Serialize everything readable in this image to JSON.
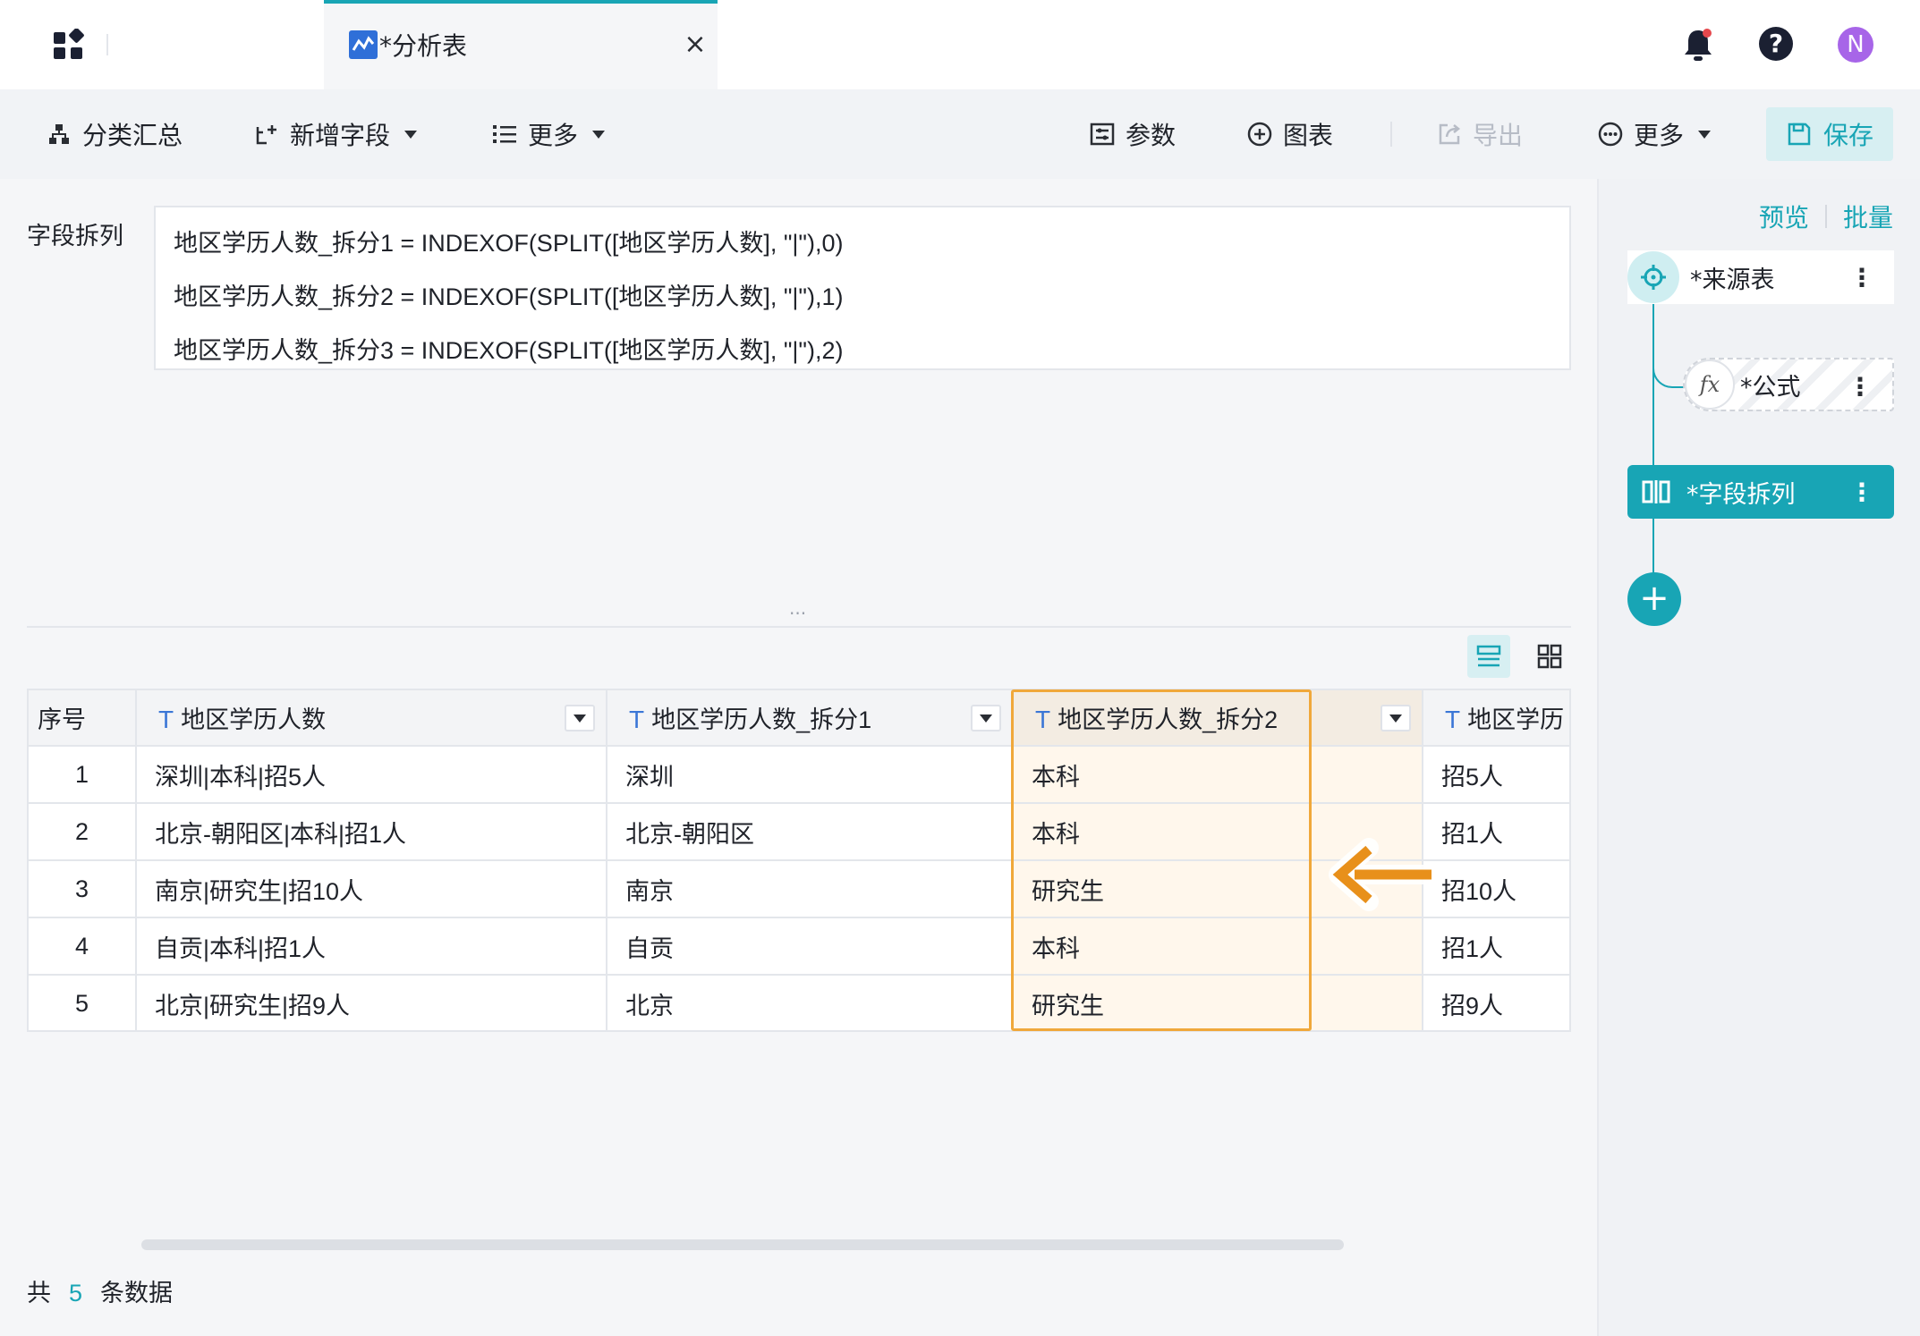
{
  "topbar": {
    "tab_title": "*分析表",
    "close_symbol": "×",
    "help_symbol": "?",
    "avatar_initial": "N"
  },
  "toolbar": {
    "group_summary": "分类汇总",
    "add_field": "新增字段",
    "more_left": "更多",
    "params": "参数",
    "chart": "图表",
    "export": "导出",
    "more_right": "更多",
    "save": "保存"
  },
  "formula": {
    "label": "字段拆列",
    "lines": [
      "地区学历人数_拆分1 = INDEXOF(SPLIT([地区学历人数], \"|\"),0)",
      "地区学历人数_拆分2 = INDEXOF(SPLIT([地区学历人数], \"|\"),1)",
      "地区学历人数_拆分3 = INDEXOF(SPLIT([地区学历人数], \"|\"),2)"
    ],
    "resize_handle": "..."
  },
  "table": {
    "headers": [
      "序号",
      "地区学历人数",
      "地区学历人数_拆分1",
      "地区学历人数_拆分2",
      "地区学历"
    ],
    "type_icon": "T",
    "rows": [
      [
        "1",
        "深圳|本科|招5人",
        "深圳",
        "本科",
        "招5人"
      ],
      [
        "2",
        "北京-朝阳区|本科|招1人",
        "北京-朝阳区",
        "本科",
        "招1人"
      ],
      [
        "3",
        "南京|研究生|招10人",
        "南京",
        "研究生",
        "招10人"
      ],
      [
        "4",
        "自贡|本科|招1人",
        "自贡",
        "本科",
        "招1人"
      ],
      [
        "5",
        "北京|研究生|招9人",
        "北京",
        "研究生",
        "招9人"
      ]
    ]
  },
  "footer": {
    "prefix": "共",
    "count": "5",
    "suffix": "条数据"
  },
  "right_panel": {
    "preview": "预览",
    "batch": "批量",
    "nodes": {
      "source": "*来源表",
      "formula": "*公式",
      "formula_icon_text": "fx",
      "split": "*字段拆列"
    },
    "more_symbol": "⋮",
    "add_symbol": "+"
  },
  "colors": {
    "accent": "#18a5b5",
    "highlight_border": "#f0a83a",
    "arrow": "#e8901a",
    "avatar": "#a765e8"
  },
  "icons": [
    "apps-icon",
    "chart-tab-icon",
    "bell-icon",
    "help-icon",
    "tree-icon",
    "add-field-icon",
    "list-icon",
    "params-icon",
    "plus-circle-icon",
    "export-icon",
    "more-circle-icon",
    "save-icon",
    "row-view-icon",
    "grid-view-icon",
    "target-icon",
    "split-column-icon",
    "arrow-left-icon"
  ]
}
